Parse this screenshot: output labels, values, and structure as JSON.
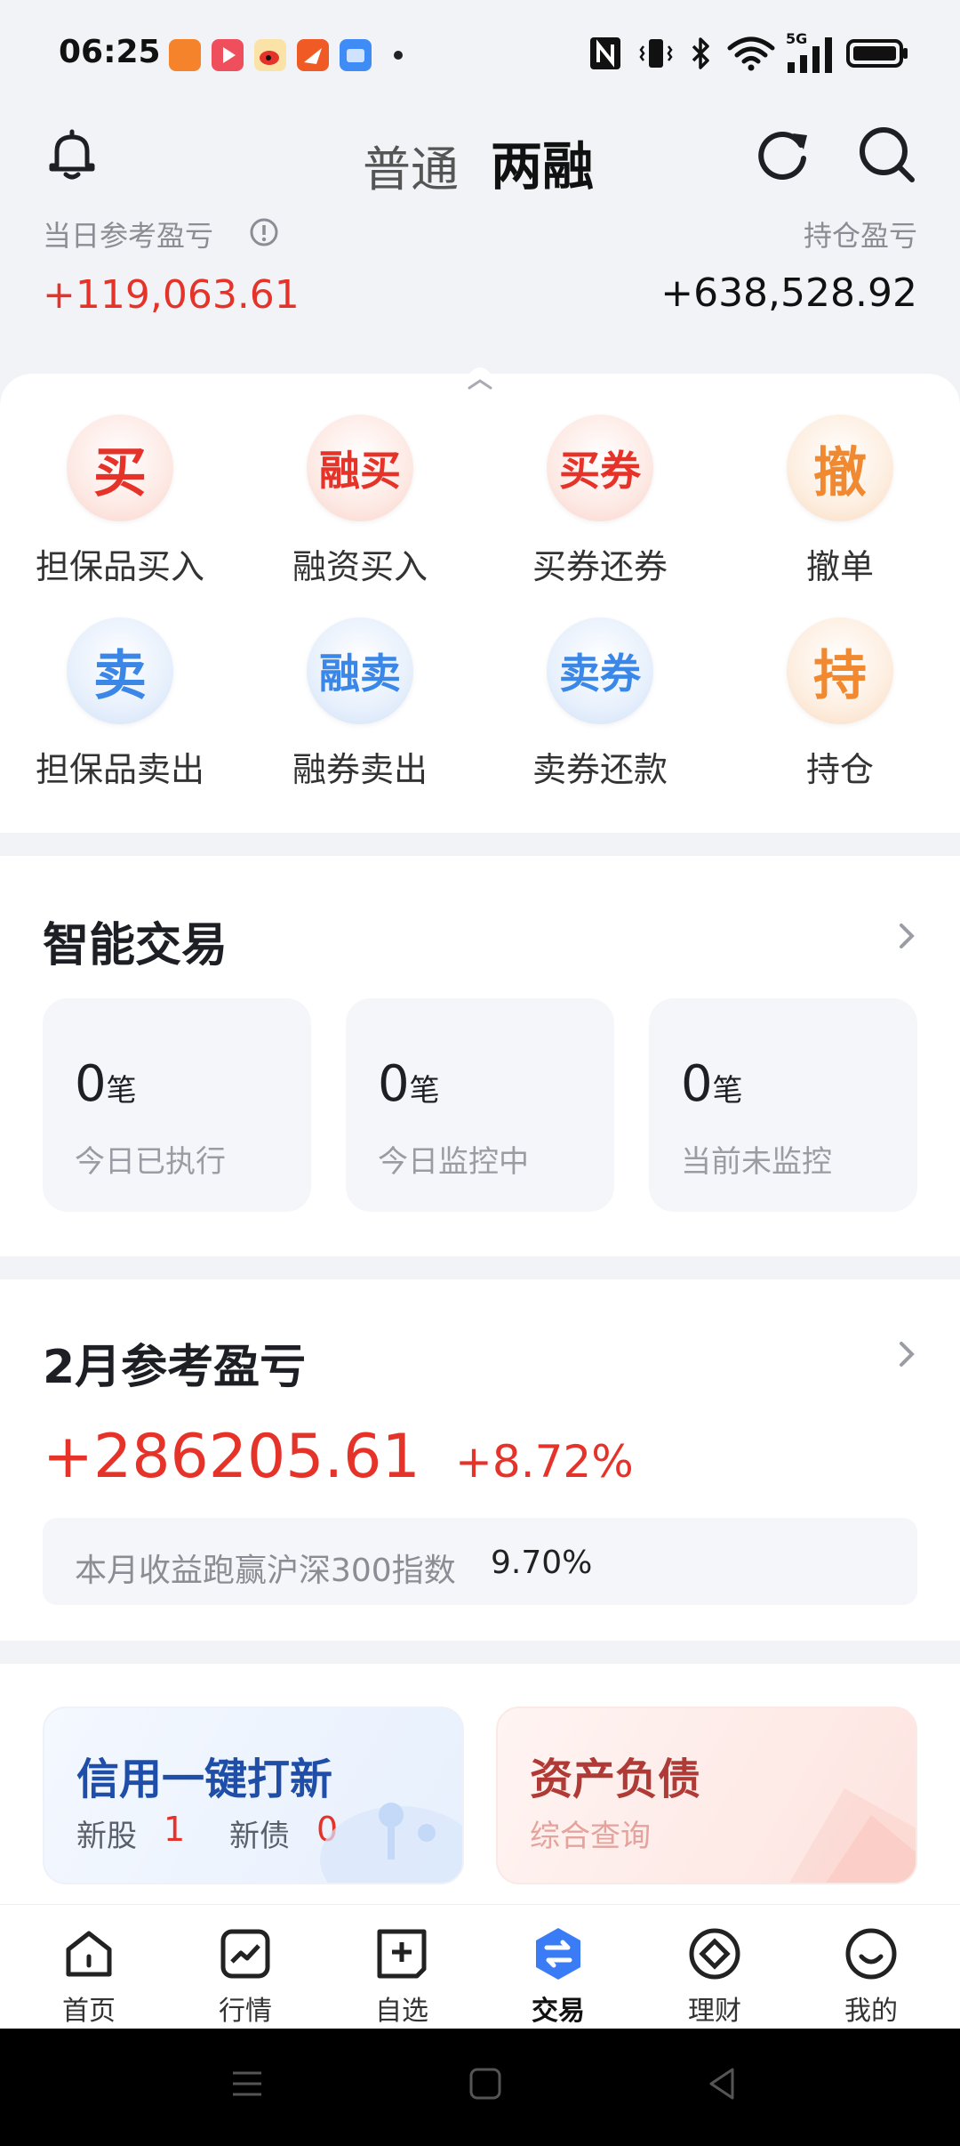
{
  "status_bar": {
    "time": "06:25",
    "icons": [
      "taobao-app-icon",
      "video-app-icon",
      "weibo-app-icon",
      "feishu-app-icon",
      "files-app-icon",
      "dot-icon",
      "nfc-icon",
      "vibrate-icon",
      "bluetooth-icon",
      "wifi-icon",
      "5g-signal-icon",
      "battery-icon"
    ],
    "network_label": "5G"
  },
  "header": {
    "tab_normal": "普通",
    "tab_margin": "两融",
    "daily_label": "当日参考盈亏",
    "daily_value": "+119,063.61",
    "holding_label": "持仓盈亏",
    "holding_value": "+638,528.92"
  },
  "quick_actions": [
    {
      "glyph": "买",
      "label": "担保品买入",
      "tone": "red"
    },
    {
      "glyph": "融买",
      "label": "融资买入",
      "tone": "red"
    },
    {
      "glyph": "买券",
      "label": "买券还券",
      "tone": "red"
    },
    {
      "glyph": "撤",
      "label": "撤单",
      "tone": "orange"
    },
    {
      "glyph": "卖",
      "label": "担保品卖出",
      "tone": "blue"
    },
    {
      "glyph": "融卖",
      "label": "融券卖出",
      "tone": "blue"
    },
    {
      "glyph": "卖券",
      "label": "卖券还款",
      "tone": "blue"
    },
    {
      "glyph": "持",
      "label": "持仓",
      "tone": "orange"
    }
  ],
  "smart_trade": {
    "title": "智能交易",
    "cards": [
      {
        "count": "0",
        "unit": "笔",
        "label": "今日已执行"
      },
      {
        "count": "0",
        "unit": "笔",
        "label": "今日监控中"
      },
      {
        "count": "0",
        "unit": "笔",
        "label": "当前未监控"
      }
    ]
  },
  "monthly": {
    "title": "2月参考盈亏",
    "value": "+286205.61",
    "percent": "+8.72%",
    "beat_text": "本月收益跑赢沪深300指数",
    "beat_value": "9.70%"
  },
  "promos": {
    "ipo_title": "信用一键打新",
    "ipo_stock_label": "新股",
    "ipo_stock_count": "1",
    "ipo_bond_label": "新债",
    "ipo_bond_count": "0",
    "asset_title": "资产负债",
    "asset_sub": "综合查询"
  },
  "nav": [
    {
      "label": "首页",
      "icon": "home-icon",
      "active": false
    },
    {
      "label": "行情",
      "icon": "market-icon",
      "active": false
    },
    {
      "label": "自选",
      "icon": "watchlist-icon",
      "active": false
    },
    {
      "label": "交易",
      "icon": "trade-icon",
      "active": true
    },
    {
      "label": "理财",
      "icon": "wealth-icon",
      "active": false
    },
    {
      "label": "我的",
      "icon": "profile-icon",
      "active": false
    }
  ],
  "colors": {
    "red": "#e6332a",
    "blue": "#3b87e8",
    "orange": "#f0892f",
    "accent": "#3a7cf5"
  }
}
